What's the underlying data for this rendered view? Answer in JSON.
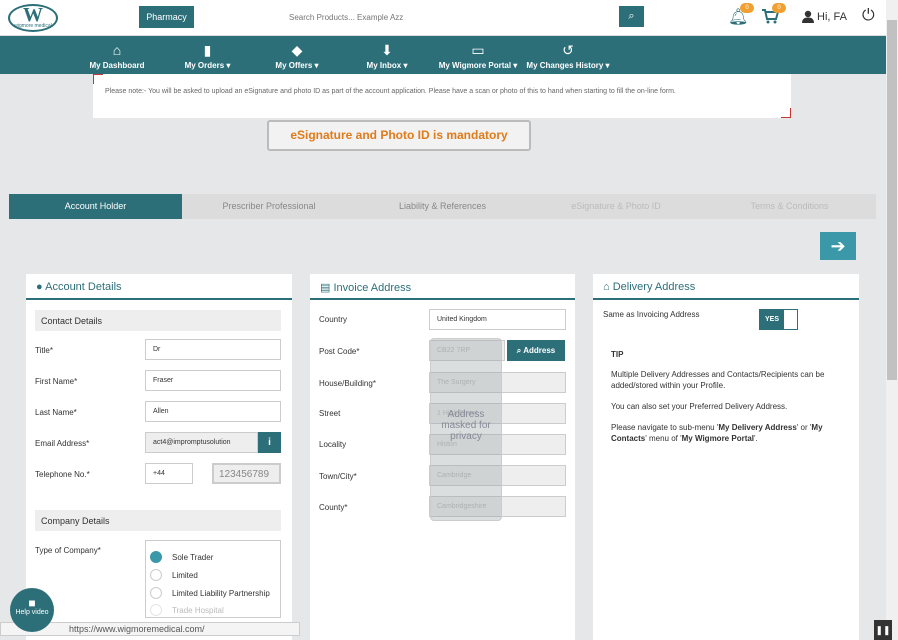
{
  "header": {
    "logo_text": "W",
    "logo_sub": "wigmore medical",
    "pharmacy_tab": "Pharmacy",
    "search_placeholder": "Search Products... Example Azz",
    "notif_count": "0",
    "cart_count": "0",
    "greeting": "Hi, FA"
  },
  "nav": [
    {
      "label": "My Dashboard",
      "icon": "home-icon"
    },
    {
      "label": "My Orders ▾",
      "icon": "file-icon"
    },
    {
      "label": "My Offers ▾",
      "icon": "tag-icon"
    },
    {
      "label": "My Inbox ▾",
      "icon": "download-icon"
    },
    {
      "label": "My Wigmore Portal ▾",
      "icon": "inbox-icon"
    },
    {
      "label": "My Changes History ▾",
      "icon": "history-icon"
    }
  ],
  "notice": "Please note:- You will be asked to upload an eSignature and photo ID as part of the account application. Please have a scan or photo of this to hand when starting to fill the on-line form.",
  "mandatory": "eSignature and Photo ID is mandatory",
  "tabs": [
    "Account Holder",
    "Prescriber Professional",
    "Liability & References",
    "eSignature & Photo ID",
    "Terms & Conditions"
  ],
  "account": {
    "title": "Account Details",
    "contact_section": "Contact Details",
    "title_label": "Title*",
    "title_value": "Dr",
    "first_label": "First Name*",
    "first_value": "Fraser",
    "last_label": "Last Name*",
    "last_value": "Allen",
    "email_label": "Email Address*",
    "email_value": "act4@impromptusolution",
    "tel_label": "Telephone No.*",
    "tel_code": "+44",
    "tel_value": "123456789",
    "company_section": "Company Details",
    "company_type_label": "Type of Company*",
    "company_types": [
      "Sole Trader",
      "Limited",
      "Limited Liability Partnership",
      "Trade Hospital"
    ]
  },
  "invoice": {
    "title": "Invoice Address",
    "country_label": "Country",
    "country_value": "United Kingdom",
    "postcode_label": "Post Code*",
    "postcode_value": "CB22 7RP",
    "address_btn": "Address",
    "house_label": "House/Building*",
    "house_value": "The Surgery",
    "street_label": "Street",
    "street_value": "1 High Street",
    "locality_label": "Locality",
    "locality_value": "Histon",
    "town_label": "Town/City*",
    "town_value": "Cambridge",
    "county_label": "County*",
    "county_value": "Cambridgeshire",
    "mask_text": "Address masked for privacy"
  },
  "delivery": {
    "title": "Delivery Address",
    "same_label": "Same as Invoicing Address",
    "toggle": "YES",
    "tip_title": "TIP",
    "tip1": "Multiple Delivery Addresses and Contacts/Recipients can be added/stored within your Profile.",
    "tip2": "You can also set your Preferred Delivery Address.",
    "tip3_a": "Please navigate to sub-menu '",
    "tip3_b": "My Delivery Address",
    "tip3_c": "' or '",
    "tip3_d": "My Contacts",
    "tip3_e": "' menu of '",
    "tip3_f": "My Wigmore Portal",
    "tip3_g": "'."
  },
  "help_video": "Help video",
  "status_url": "https://www.wigmoremedical.com/"
}
